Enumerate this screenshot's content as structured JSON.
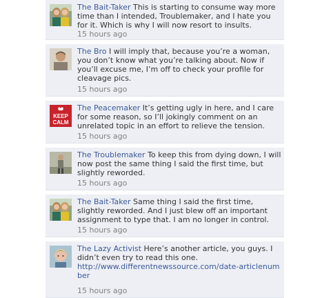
{
  "comments": [
    {
      "author": "The Bait-Taker",
      "avatar": "two-women-photo-icon",
      "text": "This is starting to consume way more time than I intended, Troublemaker, and I hate you for it. Which is why I will now resort to insults.",
      "time": "15 hours ago"
    },
    {
      "author": "The Bro",
      "avatar": "man-portrait-icon",
      "text": "I will imply that, because you’re a woman, you don’t know what you’re talking about. Now if you’ll excuse me, I’m off to check your profile for cleavage pics.",
      "time": "15 hours ago"
    },
    {
      "author": "The Peacemaker",
      "avatar": "keep-calm-poster-icon",
      "avatar_text": "KEEP CALM",
      "text": "It’s getting ugly in here, and I care for some reason, so I’ll jokingly comment on an unrelated topic in an effort to relieve the tension.",
      "time": "15 hours ago"
    },
    {
      "author": "The Troublemaker",
      "avatar": "man-standing-photo-icon",
      "text": "To keep this from dying down, I will now post the same thing I said the first time, but slightly reworded.",
      "time": "15 hours ago"
    },
    {
      "author": "The Bait-Taker",
      "avatar": "two-women-photo-icon",
      "text": "Same thing I said the first time, slightly reworded. And I just blew off an important assignment to type that. I am no longer in control.",
      "time": "15 hours ago"
    },
    {
      "author": "The Lazy Activist",
      "avatar": "child-portrait-icon",
      "text": "Here’s another article, you guys. I didn’t even try to read this one.",
      "link": "http://www.differentnewssource.com/date-articlenumber",
      "time": "15 hours ago"
    }
  ]
}
